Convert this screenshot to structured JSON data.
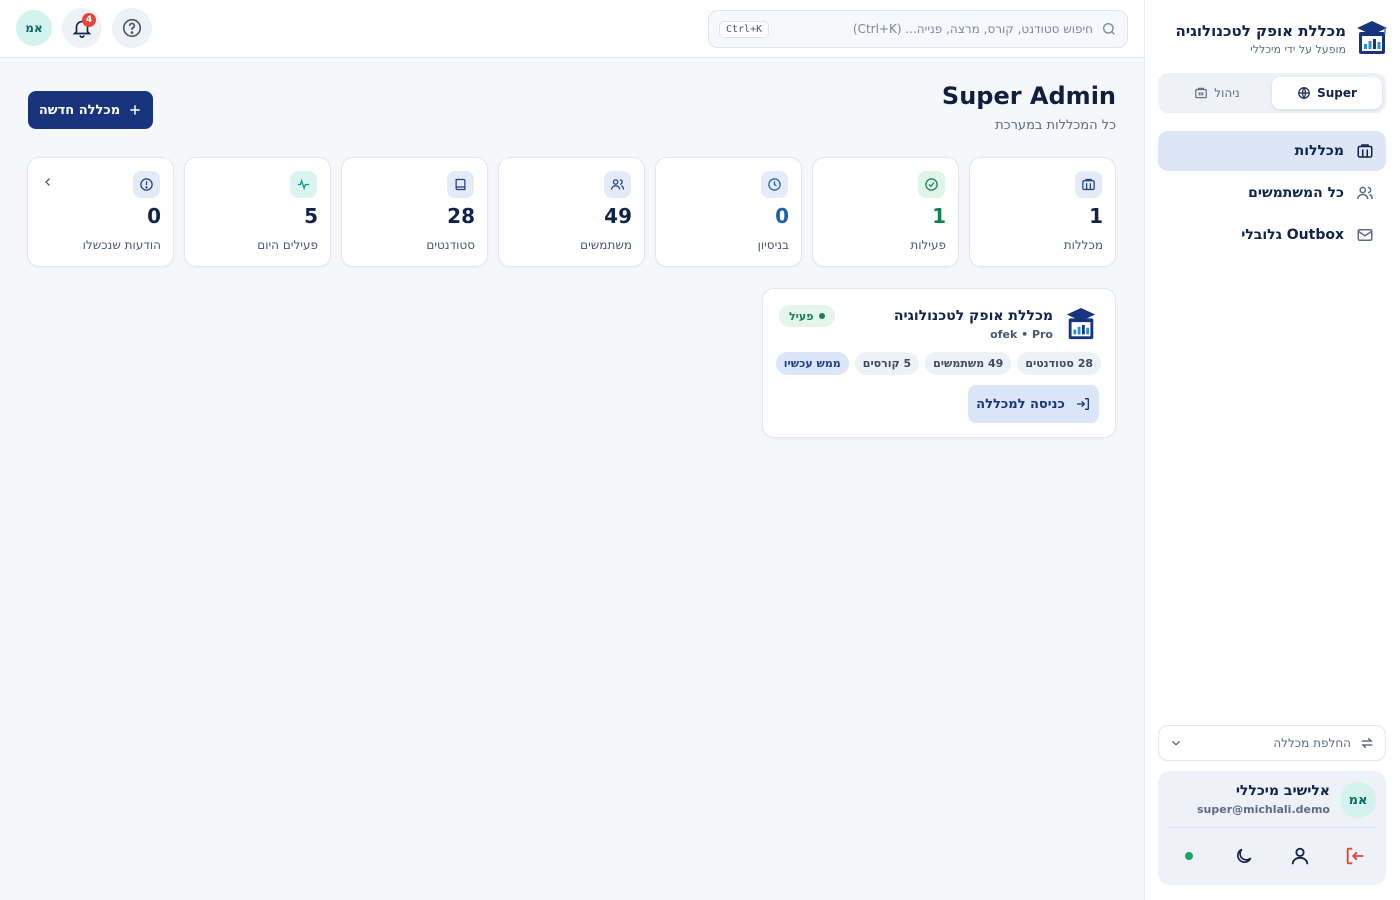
{
  "brand": {
    "name": "מכללת אופק לטכנולוגיה",
    "subtitle": "מופעל על ידי מיכללי"
  },
  "mode_switch": {
    "super_label": "Super",
    "manage_label": "ניהול"
  },
  "nav": {
    "items": [
      {
        "label": "מכללות",
        "icon": "building-icon",
        "active": true
      },
      {
        "label": "כל המשתמשים",
        "icon": "users-icon",
        "active": false
      },
      {
        "label": "Outbox גלובלי",
        "icon": "mail-icon",
        "active": false
      }
    ]
  },
  "college_switch": {
    "label": "החלפת מכללה"
  },
  "user": {
    "initials": "אמ",
    "name": "אלישיב מיכללי",
    "email": "super@michlali.demo"
  },
  "topbar": {
    "search_placeholder": "חיפוש סטודנט, קורס, מרצה, פנייה... (Ctrl+K)",
    "shortcut": "Ctrl+K",
    "notification_count": "4",
    "avatar_initials": "אמ"
  },
  "page": {
    "title": "Super Admin",
    "subtitle": "כל המכללות במערכת",
    "new_button": "מכללה חדשה"
  },
  "stats": [
    {
      "label": "מכללות",
      "value": "1",
      "icon": "building-icon",
      "color": "#10244b",
      "icon_bg": "#e4ebf7",
      "icon_color": "#1f3f87"
    },
    {
      "label": "פעילות",
      "value": "1",
      "icon": "check-circle-icon",
      "color": "#16804f",
      "icon_bg": "#e0f5e9",
      "icon_color": "#16804f"
    },
    {
      "label": "בניסיון",
      "value": "0",
      "icon": "clock-icon",
      "color": "#1f5fb0",
      "icon_bg": "#e3ecf8",
      "icon_color": "#1f5fb0"
    },
    {
      "label": "משתמשים",
      "value": "49",
      "icon": "users-icon",
      "color": "#10244b",
      "icon_bg": "#e4ebf7",
      "icon_color": "#1f3f87"
    },
    {
      "label": "סטודנטים",
      "value": "28",
      "icon": "book-icon",
      "color": "#10244b",
      "icon_bg": "#e4ebf7",
      "icon_color": "#1f3f87"
    },
    {
      "label": "פעילים היום",
      "value": "5",
      "icon": "activity-icon",
      "color": "#10244b",
      "icon_bg": "#dcf4f1",
      "icon_color": "#139486"
    },
    {
      "label": "הודעות שנכשלו",
      "value": "0",
      "icon": "alert-circle-icon",
      "color": "#10244b",
      "icon_bg": "#e4ebf7",
      "icon_color": "#1f3f87"
    }
  ],
  "college_card": {
    "name": "מכללת אופק לטכנולוגיה",
    "meta": "ofek • Pro",
    "status": "פעיל",
    "chips": [
      "28 סטודנטים",
      "49 משתמשים",
      "5 קורסים",
      "ממש עכשיו"
    ],
    "enter_button": "כניסה למכללה"
  }
}
